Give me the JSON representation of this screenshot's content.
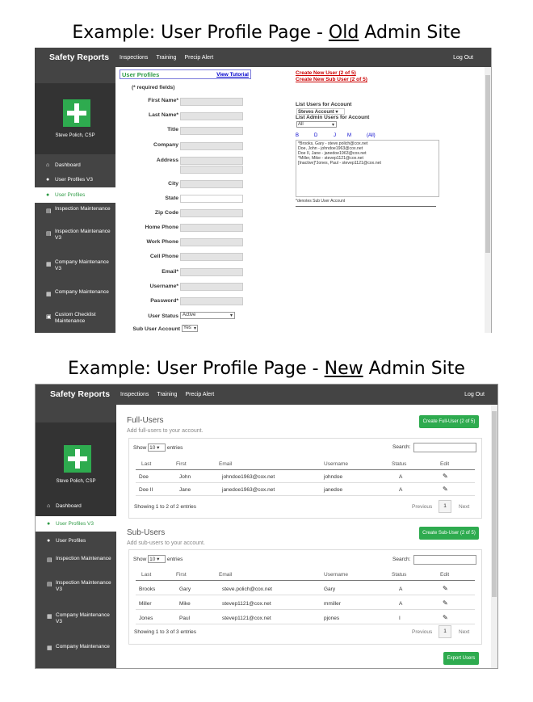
{
  "caption1": {
    "pre": "Example: User Profile Page - ",
    "u": "Old",
    "post": " Admin Site"
  },
  "caption2": {
    "pre": "Example: User Profile Page - ",
    "u": "New",
    "post": " Admin Site"
  },
  "app": {
    "brand": "Safety Reports",
    "nav": [
      "Inspections",
      "Training",
      "Precip Alert"
    ],
    "logout": "Log Out",
    "user": "Steve Polich, CSP"
  },
  "old": {
    "sidebar": [
      "Dashboard",
      "User Profiles V3",
      "User Profiles",
      "Inspection Maintenance",
      "Inspection Maintenance V3",
      "Company Maintenance V3",
      "Company Maintenance",
      "Custom Checklist Maintenance"
    ],
    "title": "User Profiles",
    "tutorial": "View Tutorial",
    "required": "(* required fields)",
    "fields": [
      "First Name*",
      "Last Name*",
      "Title",
      "Company",
      "Address",
      "City",
      "State",
      "Zip Code",
      "Home Phone",
      "Work Phone",
      "Cell Phone",
      "Email*",
      "Username*",
      "Password*",
      "User Status",
      "Sub User Account"
    ],
    "status_value": "Active",
    "sub_value": "Yes",
    "create_user": "Create New User (2 of 5)",
    "create_sub": "Create New Sub User (2 of 5)",
    "list_label": "List Users for Account",
    "account_value": "Steves Account",
    "admin_label": "List Admin Users for Account",
    "admin_value": "All",
    "letters": [
      "B",
      "D",
      "J",
      "M",
      "(All)"
    ],
    "users": [
      "*Brooks, Gary - steve.polich@cox.net",
      "Doe, John - johndoe1963@cox.net",
      "Doe II, Jane - janedoe1963@cox.net",
      "*Miller, Mike - stevep1121@cox.net",
      "[Inactive]*Jones, Paul - stevep1121@cox.net"
    ],
    "note": "*denotes Sub User Account"
  },
  "new": {
    "sidebar": [
      "Dashboard",
      "User Profiles V3",
      "User Profiles",
      "Inspection Maintenance",
      "Inspection Maintenance V3",
      "Company Maintenance V3",
      "Company Maintenance"
    ],
    "full": {
      "title": "Full-Users",
      "subtitle": "Add full-users to your account.",
      "button": "Create Full-User (2 of 5)",
      "show": "Show",
      "len": "10",
      "entries": "entries",
      "search": "Search:",
      "info": "Showing 1 to 2 of 2 entries",
      "rows": [
        [
          "Doe",
          "John",
          "johndoe1963@cox.net",
          "johndoe",
          "A"
        ],
        [
          "Doe II",
          "Jane",
          "janedoe1963@cox.net",
          "janedoe",
          "A"
        ]
      ]
    },
    "sub": {
      "title": "Sub-Users",
      "subtitle": "Add sub-users to your account.",
      "button": "Create Sub-User (2 of 5)",
      "show": "Show",
      "len": "10",
      "entries": "entries",
      "search": "Search:",
      "info": "Showing 1 to 3 of 3 entries",
      "rows": [
        [
          "Brooks",
          "Gary",
          "steve.polich@cox.net",
          "Gary",
          "A"
        ],
        [
          "Miller",
          "Mike",
          "stevep1121@cox.net",
          "mmiller",
          "A"
        ],
        [
          "Jones",
          "Paul",
          "stevep1121@cox.net",
          "pjones",
          "I"
        ]
      ]
    },
    "columns": [
      "Last",
      "First",
      "Email",
      "Username",
      "Status",
      "Edit"
    ],
    "pager": {
      "prev": "Previous",
      "page": "1",
      "next": "Next"
    },
    "export": "Export Users"
  }
}
